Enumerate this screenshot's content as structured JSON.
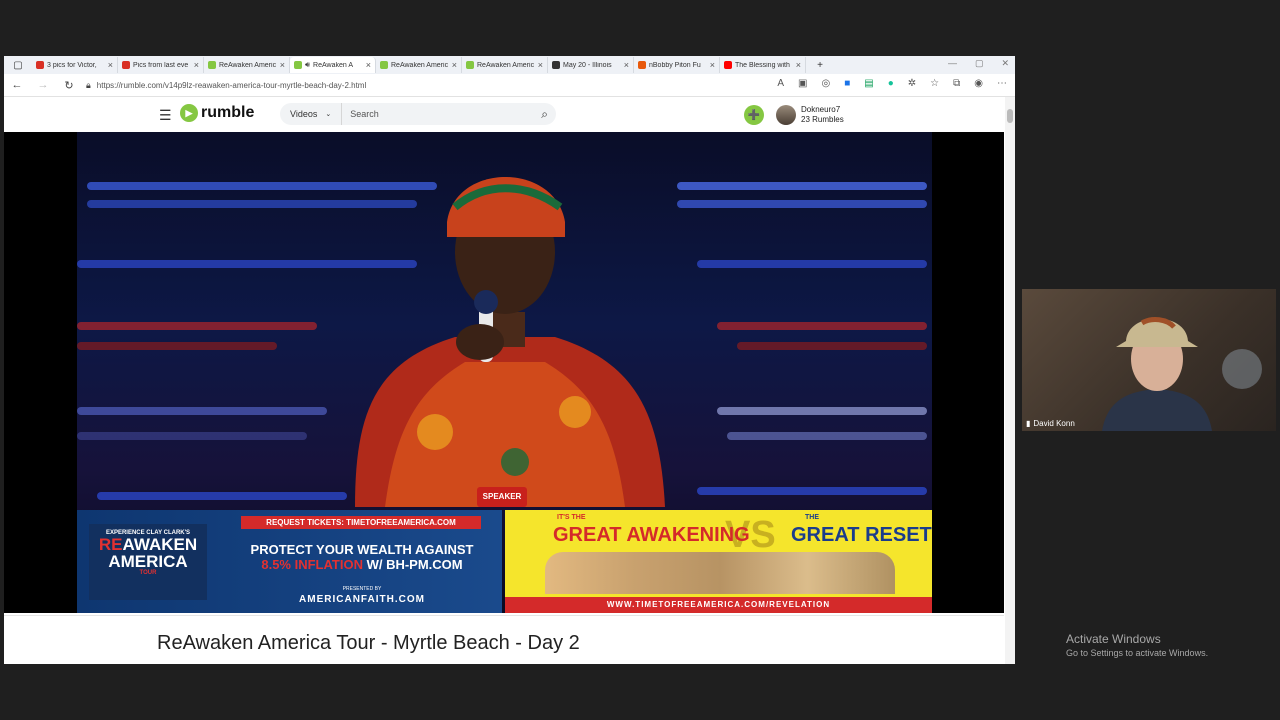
{
  "browser": {
    "tabs": [
      {
        "title": "3 pics for Victor,",
        "color": "#d93025"
      },
      {
        "title": "Pics from last eve",
        "color": "#d93025"
      },
      {
        "title": "ReAwaken Americ",
        "color": "#85c742"
      },
      {
        "title": "ReAwaken A",
        "color": "#85c742",
        "active": true
      },
      {
        "title": "ReAwaken Americ",
        "color": "#85c742"
      },
      {
        "title": "ReAwaken Americ",
        "color": "#85c742"
      },
      {
        "title": "May 20 - Illinois",
        "color": "#333333"
      },
      {
        "title": "nBobby Piton Fu",
        "color": "#e8590c"
      },
      {
        "title": "The Blessing with",
        "color": "#ff0000"
      }
    ],
    "new_tab": "+",
    "url": "https://rumble.com/v14p9lz-reawaken-america-tour-myrtle-beach-day-2.html"
  },
  "site": {
    "logo_text": "rumble",
    "search": {
      "category": "Videos",
      "placeholder": "Search"
    },
    "user": {
      "name": "Dokneuro7",
      "rumbles": "23 Rumbles"
    }
  },
  "banner_left": {
    "experience": "EXPERIENCE CLAY CLARK'S",
    "re": "RE",
    "awaken": "AWAKEN",
    "america": "AMERICA",
    "tour": "TOUR",
    "tickets": "REQUEST TICKETS: TIMETOFREEAMERICA.COM",
    "line1": "PROTECT YOUR WEALTH AGAINST",
    "line2_hl": "8.5% INFLATION",
    "line2_rest": " W/ BH-PM.COM",
    "presented": "PRESENTED BY",
    "sponsor": "AMERICANFAITH.COM"
  },
  "banner_right": {
    "its_the": "IT'S THE",
    "the": "THE",
    "great_awakening": "GREAT AWAKENING",
    "vs": "VS",
    "great_reset": "GREAT RESET",
    "url": "WWW.TIMETOFREEAMERICA.COM/REVELATION"
  },
  "video": {
    "badge": "SPEAKER",
    "title": "ReAwaken America Tour - Myrtle Beach - Day 2"
  },
  "webcam": {
    "name": "David Konn"
  },
  "windows": {
    "activate_title": "Activate Windows",
    "activate_sub": "Go to Settings to activate Windows."
  }
}
